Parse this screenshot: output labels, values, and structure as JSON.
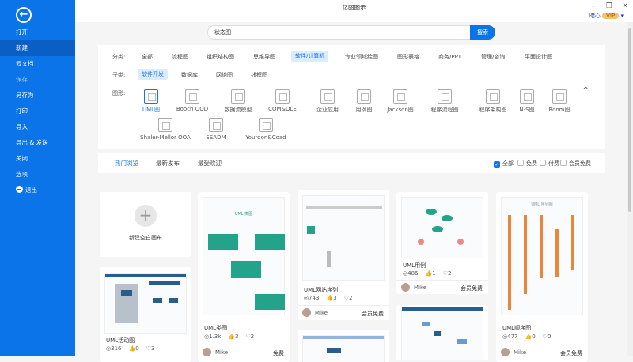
{
  "window": {
    "title": "亿图图示",
    "minimize": "–",
    "restore": "❐",
    "close": "✕",
    "user": "暗心",
    "vip": "VIP"
  },
  "sidebar": {
    "items": [
      {
        "label": "打开"
      },
      {
        "label": "新建"
      },
      {
        "label": "云文档"
      },
      {
        "label": "保存"
      },
      {
        "label": "另存为"
      },
      {
        "label": "打印"
      },
      {
        "label": "导入"
      },
      {
        "label": "导出 & 发送"
      },
      {
        "label": "关闭"
      },
      {
        "label": "选项"
      },
      {
        "label": "退出"
      }
    ]
  },
  "search": {
    "value": "状态图",
    "button": "搜索"
  },
  "filters": {
    "category_label": "分类:",
    "categories": [
      "全部",
      "流程图",
      "组织结构图",
      "思维导图",
      "软件/计算机",
      "专业领域绘图",
      "图形表格",
      "商务/PPT",
      "管理/咨询",
      "平面设计图"
    ],
    "sub_label": "子类:",
    "subs": [
      "软件开发",
      "数据库",
      "网络图",
      "线框图"
    ],
    "shape_label": "图形:",
    "shapes": [
      "UML图",
      "Booch OOD",
      "数据流模型",
      "COM&OLE",
      "企业应用",
      "用例图",
      "Jackson图",
      "程序流程图",
      "程序架构图",
      "N-S图",
      "Room图",
      "Shaler-Mellor OOA",
      "SSADM",
      "Yourdon&Coad"
    ],
    "collapse": "^"
  },
  "tabs": [
    "热门浏览",
    "最新发布",
    "最受欢迎"
  ],
  "price_filters": [
    "全部",
    "免费",
    "付费",
    "会员免费"
  ],
  "new_blank": "新建空白画布",
  "cards": [
    {
      "title": "UML活动图",
      "views": "316",
      "likes": "0",
      "favs": "3"
    },
    {
      "title": "UML类图",
      "thumb": "UML 类图",
      "views": "1.3k",
      "likes": "3",
      "favs": "2",
      "user": "Mike",
      "price": "免费"
    },
    {
      "title": "UML网站序列",
      "views": "743",
      "likes": "3",
      "favs": "2",
      "user": "Mike",
      "price": "会员免费"
    },
    {
      "title": "UML用例",
      "views": "486",
      "likes": "1",
      "favs": "2",
      "user": "Mike",
      "price": "会员免费"
    },
    {
      "title": "UML顺序图",
      "thumb": "UML 序列图",
      "views": "477",
      "likes": "0",
      "favs": "0",
      "user": "Mike",
      "price": "会员免费"
    }
  ]
}
